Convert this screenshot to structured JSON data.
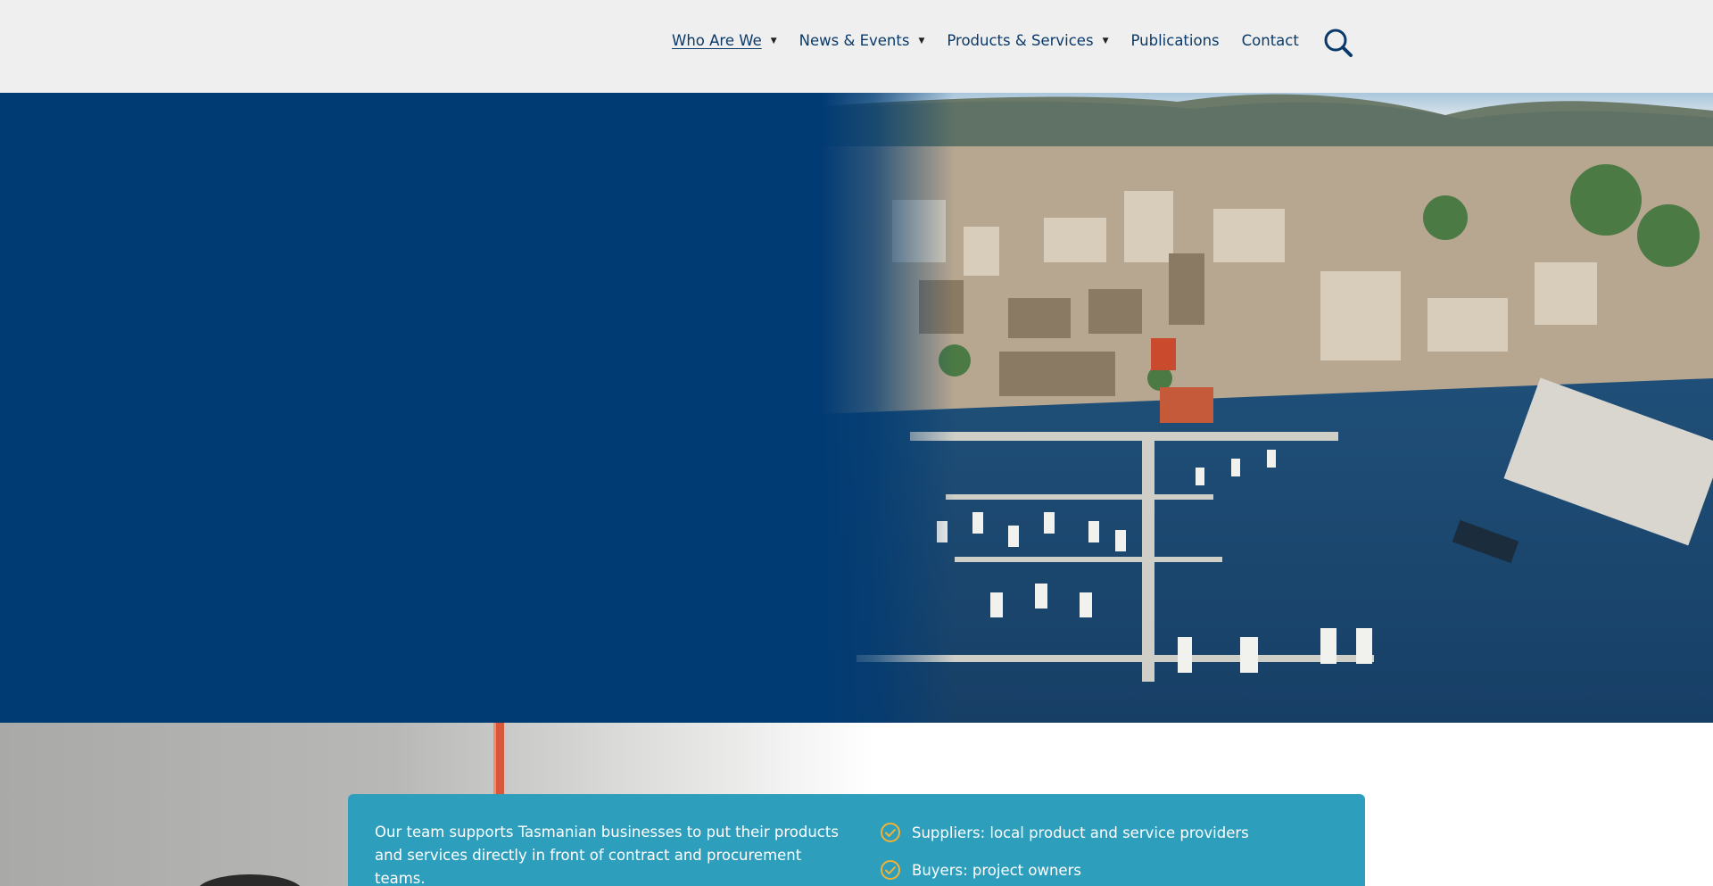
{
  "nav": {
    "items": [
      {
        "label": "Who Are We",
        "has_dropdown": true,
        "active": true
      },
      {
        "label": "News & Events",
        "has_dropdown": true,
        "active": false
      },
      {
        "label": "Products & Services",
        "has_dropdown": true,
        "active": false
      },
      {
        "label": "Publications",
        "has_dropdown": false,
        "active": false
      },
      {
        "label": "Contact",
        "has_dropdown": false,
        "active": false
      }
    ],
    "caret": "▼",
    "search_icon": "search-icon"
  },
  "hero": {
    "background_color": "#013b73",
    "photo": "aerial-harbour-city-photo"
  },
  "info": {
    "text": "Our team supports Tasmanian businesses to put their products and services directly in front of contract and procurement teams.",
    "card_color": "#2e9ebd",
    "check_color": "#f2b233",
    "items": [
      {
        "label": "Suppliers: local product and service providers"
      },
      {
        "label": "Buyers: project owners"
      }
    ]
  }
}
